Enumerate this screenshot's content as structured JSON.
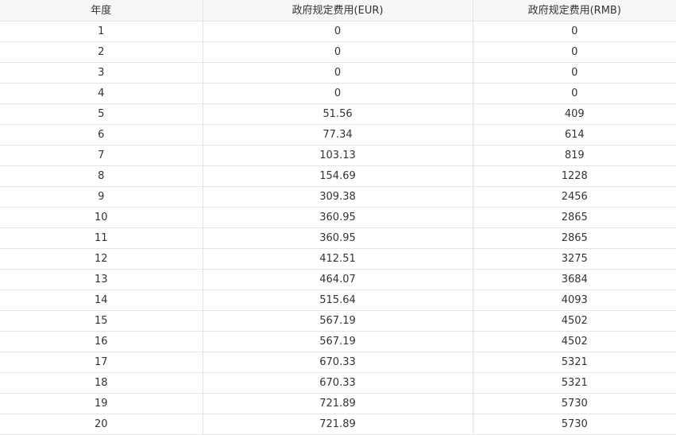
{
  "table": {
    "headers": [
      "年度",
      "政府规定费用(EUR)",
      "政府规定费用(RMB)"
    ],
    "rows": [
      [
        "1",
        "0",
        "0"
      ],
      [
        "2",
        "0",
        "0"
      ],
      [
        "3",
        "0",
        "0"
      ],
      [
        "4",
        "0",
        "0"
      ],
      [
        "5",
        "51.56",
        "409"
      ],
      [
        "6",
        "77.34",
        "614"
      ],
      [
        "7",
        "103.13",
        "819"
      ],
      [
        "8",
        "154.69",
        "1228"
      ],
      [
        "9",
        "309.38",
        "2456"
      ],
      [
        "10",
        "360.95",
        "2865"
      ],
      [
        "11",
        "360.95",
        "2865"
      ],
      [
        "12",
        "412.51",
        "3275"
      ],
      [
        "13",
        "464.07",
        "3684"
      ],
      [
        "14",
        "515.64",
        "4093"
      ],
      [
        "15",
        "567.19",
        "4502"
      ],
      [
        "16",
        "567.19",
        "4502"
      ],
      [
        "17",
        "670.33",
        "5321"
      ],
      [
        "18",
        "670.33",
        "5321"
      ],
      [
        "19",
        "721.89",
        "5730"
      ],
      [
        "20",
        "721.89",
        "5730"
      ]
    ]
  }
}
